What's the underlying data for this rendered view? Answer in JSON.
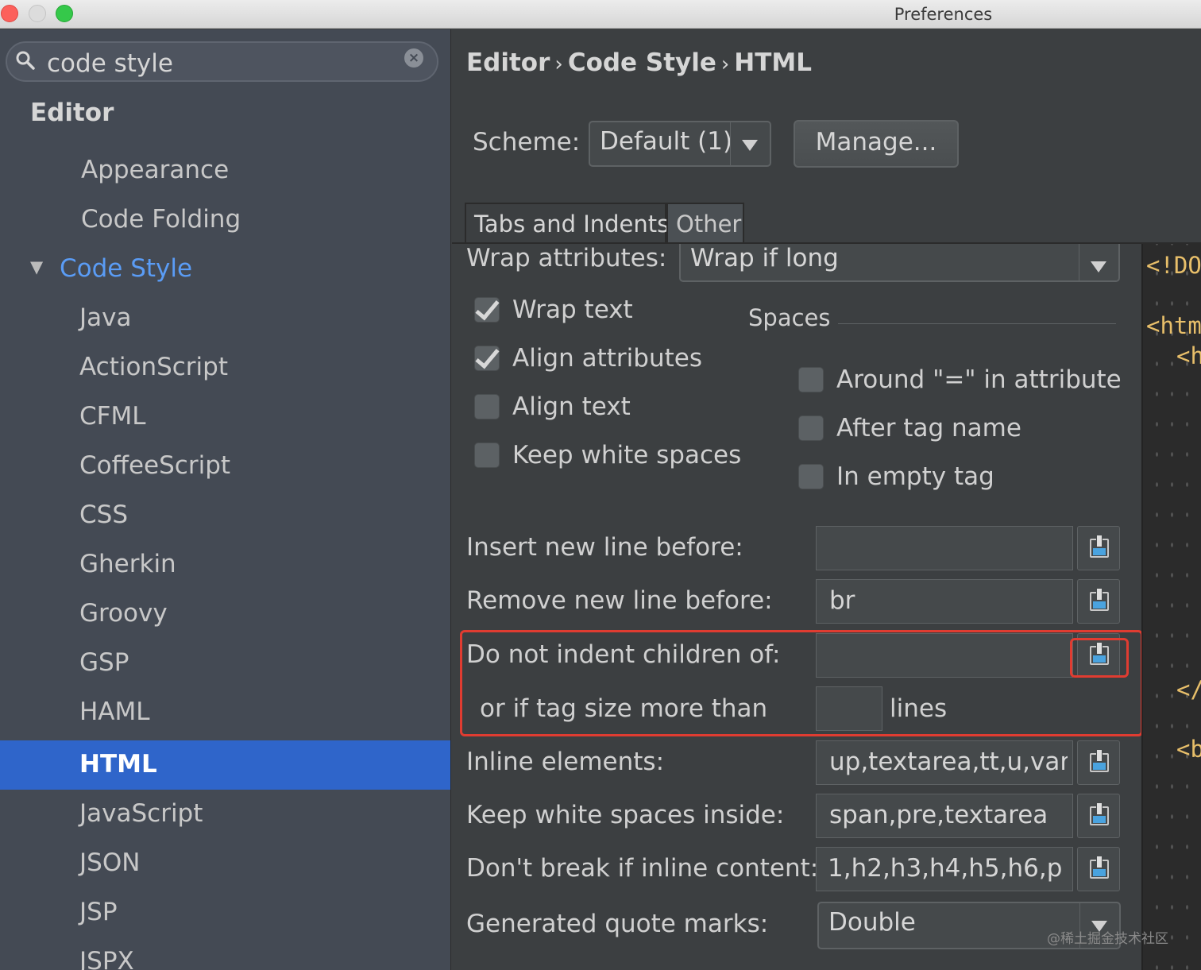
{
  "window": {
    "title": "Preferences"
  },
  "search": {
    "value": "code style"
  },
  "sidebar": {
    "items": [
      {
        "label": "Editor"
      },
      {
        "label": "Appearance"
      },
      {
        "label": "Code Folding"
      },
      {
        "label": "Code Style"
      },
      {
        "label": "Java"
      },
      {
        "label": "ActionScript"
      },
      {
        "label": "CFML"
      },
      {
        "label": "CoffeeScript"
      },
      {
        "label": "CSS"
      },
      {
        "label": "Gherkin"
      },
      {
        "label": "Groovy"
      },
      {
        "label": "GSP"
      },
      {
        "label": "HAML"
      },
      {
        "label": "HTML"
      },
      {
        "label": "JavaScript"
      },
      {
        "label": "JSON"
      },
      {
        "label": "JSP"
      },
      {
        "label": "JSPX"
      }
    ],
    "selected": "HTML"
  },
  "breadcrumb": {
    "items": [
      "Editor",
      "Code Style",
      "HTML"
    ]
  },
  "scheme": {
    "label": "Scheme:",
    "value": "Default (1)",
    "manage_label": "Manage..."
  },
  "tabs": [
    {
      "label": "Tabs and Indents"
    },
    {
      "label": "Other"
    }
  ],
  "wrap_attributes": {
    "label": "Wrap attributes:",
    "value": "Wrap if long"
  },
  "checkboxes_left": [
    {
      "label": "Wrap text",
      "checked": true
    },
    {
      "label": "Align attributes",
      "checked": true
    },
    {
      "label": "Align text",
      "checked": false
    },
    {
      "label": "Keep white spaces",
      "checked": false
    }
  ],
  "spaces": {
    "title": "Spaces",
    "items": [
      {
        "label": "Around \"=\" in attribute",
        "checked": false
      },
      {
        "label": "After tag name",
        "checked": false
      },
      {
        "label": "In empty tag",
        "checked": false
      }
    ]
  },
  "fields": {
    "insert_new_line_before": {
      "label": "Insert new line before:",
      "value": ""
    },
    "remove_new_line_before": {
      "label": "Remove new line before:",
      "value": "br"
    },
    "do_not_indent_children": {
      "label": "Do not indent children of:",
      "value": ""
    },
    "tag_size": {
      "label": "or if tag size more than",
      "value": "",
      "suffix": "lines"
    },
    "inline_elements": {
      "label": "Inline elements:",
      "value": "up,textarea,tt,u,var"
    },
    "keep_white_spaces_inside": {
      "label": "Keep white spaces inside:",
      "value": "span,pre,textarea"
    },
    "dont_break_inline": {
      "label": "Don't break if inline content:",
      "value": "1,h2,h3,h4,h5,h6,p"
    },
    "generated_quote_marks": {
      "label": "Generated quote marks:",
      "value": "Double"
    }
  },
  "preview": {
    "lines": [
      "<!DO",
      "<htm",
      "<h",
      "</",
      "<b"
    ]
  },
  "watermark": "@稀土掘金技术社区",
  "colors": {
    "selection": "#2f65ca",
    "highlight": "#e03c31",
    "link": "#5a9cf5",
    "code_tag": "#e8bf6a"
  }
}
